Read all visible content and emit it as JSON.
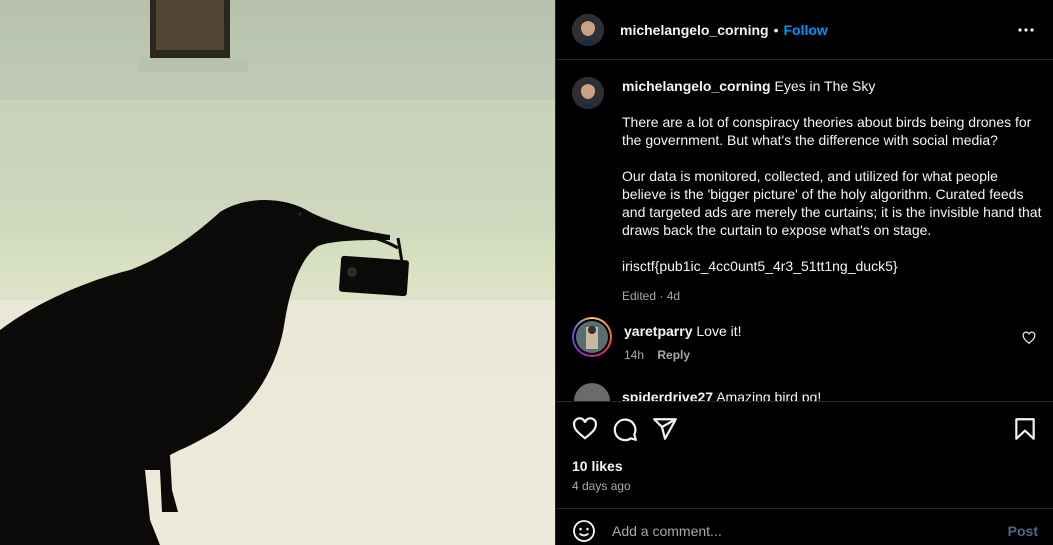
{
  "post": {
    "image_alt": "Silhouette of a crow holding a camera in its beak",
    "author": "michelangelo_corning",
    "follow_separator": "•",
    "follow_label": "Follow",
    "caption": {
      "title": "Eyes in The Sky",
      "paragraph1": "There are a lot of conspiracy theories about birds being drones for the government. But what's the difference with social media?",
      "paragraph2": "Our data is monitored, collected, and utilized for what people believe is the 'bigger picture' of the holy algorithm. Curated feeds and targeted ads are merely the curtains; it is the invisible hand that draws back the curtain to expose what's on stage.",
      "paragraph3": "irisctf{pub1ic_4cc0unt5_4r3_51tt1ng_duck5}",
      "meta": "Edited · 4d"
    },
    "comments": [
      {
        "user": "yaretparry",
        "text": "Love it!",
        "time": "14h",
        "reply_label": "Reply"
      },
      {
        "user": "spiderdrive27",
        "text": "Amazing bird pg!"
      }
    ],
    "likes": "10 likes",
    "time_ago": "4 days ago",
    "add_comment_placeholder": "Add a comment...",
    "post_label": "Post"
  },
  "colors": {
    "accent_blue": "#0095f6",
    "muted_text": "#a8a8a8",
    "divider": "#262626",
    "post_disabled": "#4a6a8a"
  },
  "icons": [
    "more-icon",
    "heart-icon",
    "comment-icon",
    "share-icon",
    "bookmark-icon",
    "emoji-icon",
    "small-heart-icon"
  ]
}
